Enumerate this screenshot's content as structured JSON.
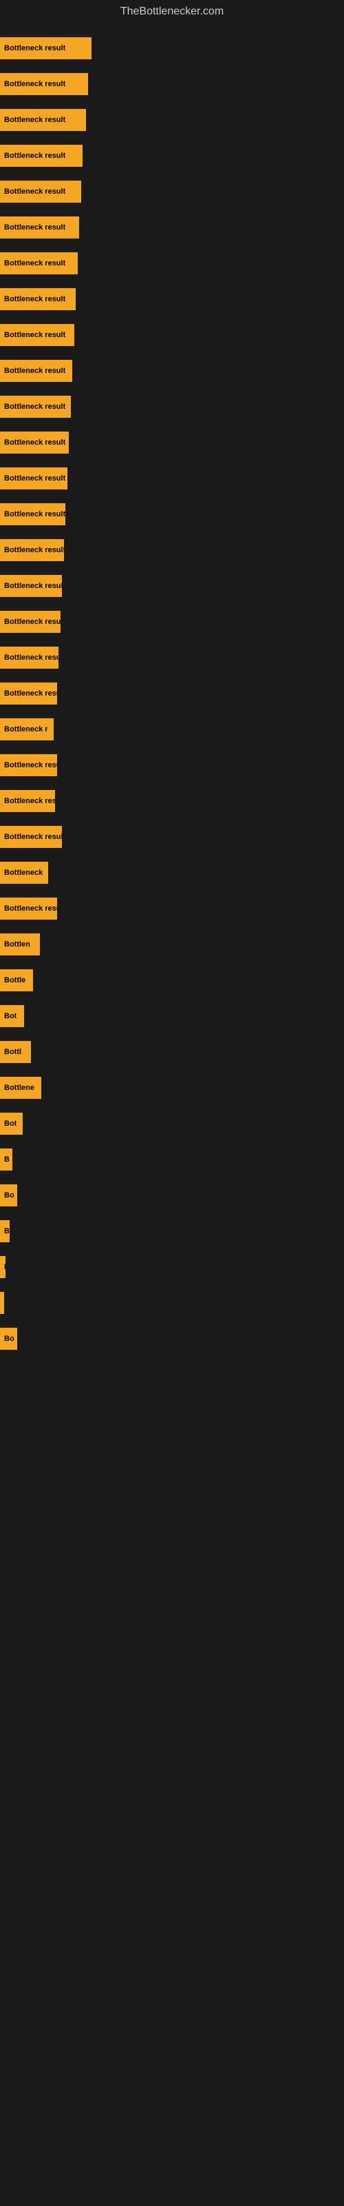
{
  "site": {
    "title": "TheBottlenecker.com"
  },
  "bars": [
    {
      "label": "Bottleneck result",
      "width": 133
    },
    {
      "label": "Bottleneck result",
      "width": 128
    },
    {
      "label": "Bottleneck result",
      "width": 125
    },
    {
      "label": "Bottleneck result",
      "width": 120
    },
    {
      "label": "Bottleneck result",
      "width": 118
    },
    {
      "label": "Bottleneck result",
      "width": 115
    },
    {
      "label": "Bottleneck result",
      "width": 113
    },
    {
      "label": "Bottleneck result",
      "width": 110
    },
    {
      "label": "Bottleneck result",
      "width": 108
    },
    {
      "label": "Bottleneck result",
      "width": 105
    },
    {
      "label": "Bottleneck result",
      "width": 103
    },
    {
      "label": "Bottleneck result",
      "width": 100
    },
    {
      "label": "Bottleneck result",
      "width": 98
    },
    {
      "label": "Bottleneck result",
      "width": 95
    },
    {
      "label": "Bottleneck result",
      "width": 93
    },
    {
      "label": "Bottleneck result",
      "width": 90
    },
    {
      "label": "Bottleneck result",
      "width": 88
    },
    {
      "label": "Bottleneck result",
      "width": 85
    },
    {
      "label": "Bottleneck resu",
      "width": 83
    },
    {
      "label": "Bottleneck r",
      "width": 78
    },
    {
      "label": "Bottleneck resu",
      "width": 83
    },
    {
      "label": "Bottleneck res",
      "width": 80
    },
    {
      "label": "Bottleneck result",
      "width": 90
    },
    {
      "label": "Bottleneck",
      "width": 70
    },
    {
      "label": "Bottleneck resu",
      "width": 83
    },
    {
      "label": "Bottlen",
      "width": 58
    },
    {
      "label": "Bottle",
      "width": 48
    },
    {
      "label": "Bot",
      "width": 35
    },
    {
      "label": "Bottl",
      "width": 45
    },
    {
      "label": "Bottlene",
      "width": 60
    },
    {
      "label": "Bot",
      "width": 33
    },
    {
      "label": "B",
      "width": 18
    },
    {
      "label": "Bo",
      "width": 25
    },
    {
      "label": "B",
      "width": 14
    },
    {
      "label": "I",
      "width": 8
    },
    {
      "label": "",
      "width": 4
    },
    {
      "label": "Bo",
      "width": 25
    }
  ]
}
